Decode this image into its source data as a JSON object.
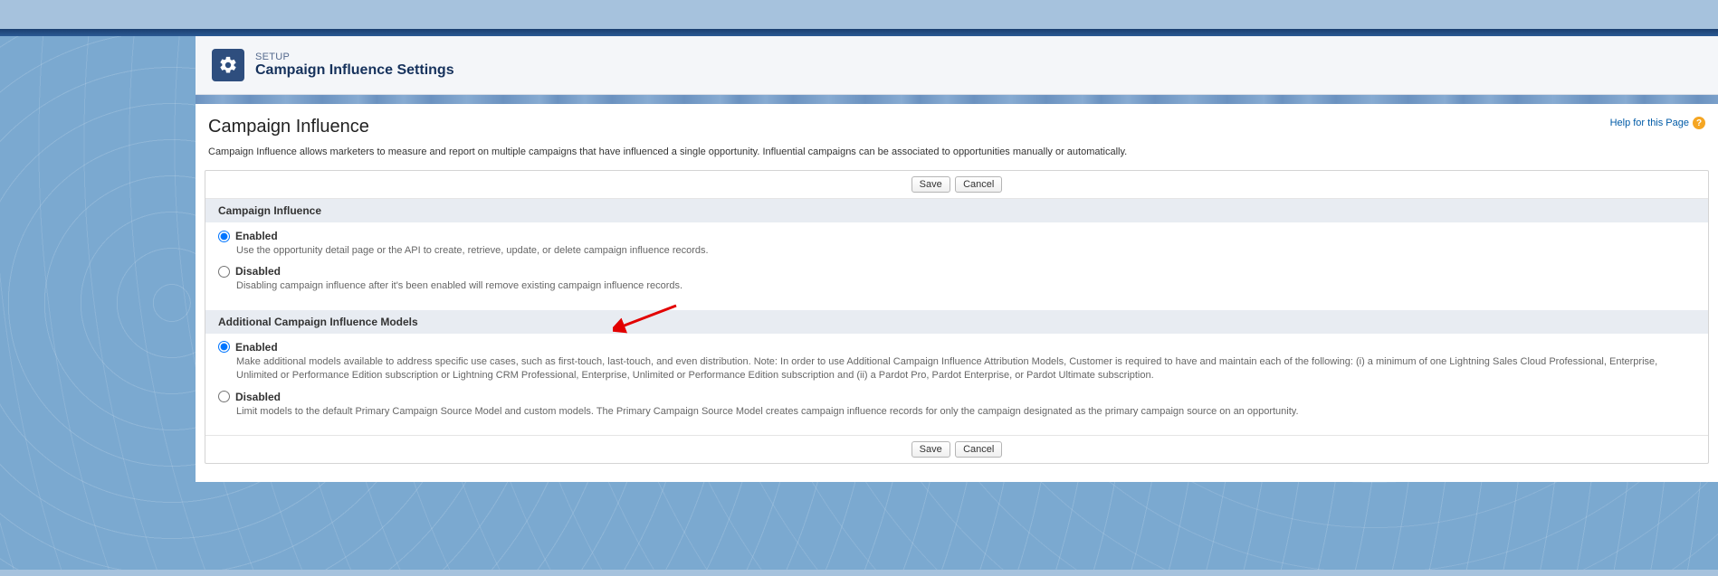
{
  "header": {
    "subtitle": "SETUP",
    "title": "Campaign Influence Settings"
  },
  "page": {
    "heading": "Campaign Influence",
    "help_link": "Help for this Page",
    "intro": "Campaign Influence allows marketers to measure and report on multiple campaigns that have influenced a single opportunity. Influential campaigns can be associated to opportunities manually or automatically."
  },
  "buttons": {
    "save": "Save",
    "cancel": "Cancel"
  },
  "sections": {
    "campaign_influence": {
      "title": "Campaign Influence",
      "enabled": {
        "label": "Enabled",
        "desc": "Use the opportunity detail page or the API to create, retrieve, update, or delete campaign influence records."
      },
      "disabled": {
        "label": "Disabled",
        "desc": "Disabling campaign influence after it's been enabled will remove existing campaign influence records."
      }
    },
    "additional_models": {
      "title": "Additional Campaign Influence Models",
      "enabled": {
        "label": "Enabled",
        "desc": "Make additional models available to address specific use cases, such as first-touch, last-touch, and even distribution. Note: In order to use Additional Campaign Influence Attribution Models, Customer is required to have and maintain each of the following: (i) a minimum of one Lightning Sales Cloud Professional, Enterprise, Unlimited or Performance Edition subscription or Lightning CRM Professional, Enterprise, Unlimited or Performance Edition subscription and (ii) a Pardot Pro, Pardot Enterprise, or Pardot Ultimate subscription."
      },
      "disabled": {
        "label": "Disabled",
        "desc": "Limit models to the default Primary Campaign Source Model and custom models. The Primary Campaign Source Model creates campaign influence records for only the campaign designated as the primary campaign source on an opportunity."
      }
    }
  }
}
